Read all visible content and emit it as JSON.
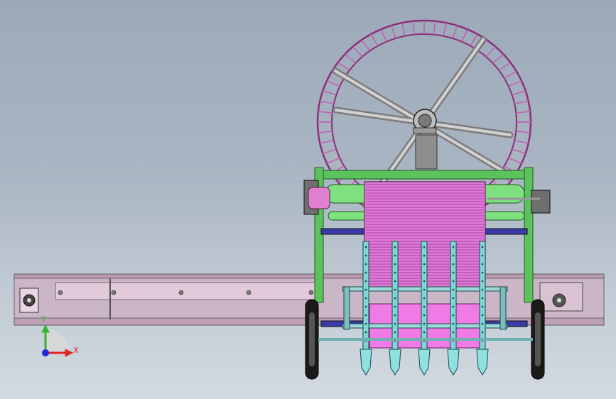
{
  "viewport": {
    "background_top": "#9ca9b8",
    "background_bottom": "#d3d9e0"
  },
  "model": {
    "wheel_color": "#d77fc4",
    "frame_color": "#5cc25c",
    "rail_color": "#d8b7cf",
    "belt_color": "#e07ad8",
    "tine_color": "#7fd6d6"
  },
  "triad": {
    "y_label": "Y",
    "x_label": "X",
    "y_color": "#2fb52f",
    "x_color": "#e02424",
    "z_color": "#2424e0"
  }
}
